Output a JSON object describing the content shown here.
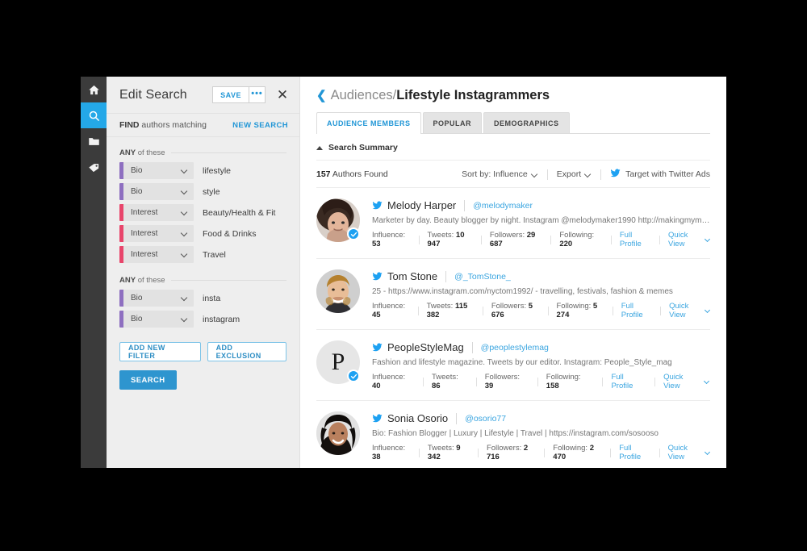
{
  "rail": {
    "items": [
      {
        "name": "home-icon",
        "label": "Home"
      },
      {
        "name": "search-icon",
        "label": "Search",
        "active": true
      },
      {
        "name": "folder-icon",
        "label": "Folders"
      },
      {
        "name": "tag-icon",
        "label": "Tags"
      }
    ],
    "active_color": "#24a8e8",
    "background": "#3b3b3b"
  },
  "edit_panel": {
    "title": "Edit Search",
    "save_label": "SAVE",
    "more_label": "•••",
    "close_label": "✕",
    "find_prefix": "FIND",
    "find_suffix": "authors matching",
    "new_search_label": "NEW SEARCH",
    "group1": {
      "any_bold": "ANY",
      "any_rest": "of these",
      "filters": [
        {
          "field": "Bio",
          "value": "lifestyle",
          "color": "#8e6fc0",
          "kind": "bio"
        },
        {
          "field": "Bio",
          "value": "style",
          "color": "#8e6fc0",
          "kind": "bio"
        },
        {
          "field": "Interest",
          "value": "Beauty/Health & Fit",
          "color": "#e8456b",
          "kind": "interest"
        },
        {
          "field": "Interest",
          "value": "Food & Drinks",
          "color": "#e8456b",
          "kind": "interest"
        },
        {
          "field": "Interest",
          "value": "Travel",
          "color": "#e8456b",
          "kind": "interest"
        }
      ]
    },
    "group2": {
      "any_bold": "ANY",
      "any_rest": "of these",
      "filters": [
        {
          "field": "Bio",
          "value": "insta",
          "color": "#8e6fc0",
          "kind": "bio"
        },
        {
          "field": "Bio",
          "value": "instagram",
          "color": "#8e6fc0",
          "kind": "bio"
        }
      ]
    },
    "add_filter_label": "ADD NEW FILTER",
    "add_exclusion_label": "ADD EXCLUSION",
    "search_label": "SEARCH"
  },
  "main": {
    "breadcrumb": {
      "back_icon": "❮",
      "parent": "Audiences/",
      "current": "Lifestyle Instagrammers"
    },
    "tabs": [
      {
        "label": "AUDIENCE MEMBERS",
        "active": true
      },
      {
        "label": "POPULAR",
        "active": false
      },
      {
        "label": "DEMOGRAPHICS",
        "active": false
      }
    ],
    "summary_label": "Search Summary",
    "found_count": "157",
    "found_suffix": "Authors Found",
    "sort_label": "Sort by: Influence",
    "export_label": "Export",
    "twitter_ads_label": "Target with Twitter Ads",
    "stat_labels": {
      "influence": "Influence:",
      "tweets": "Tweets:",
      "followers": "Followers:",
      "following": "Following:"
    },
    "full_profile_label": "Full Profile",
    "quick_view_label": "Quick View",
    "results": [
      {
        "name": "Melody Harper",
        "handle": "@melodymaker",
        "bio": "Marketer by day. Beauty blogger by night. Instagram @melodymaker1990 http://makingmymelody.me",
        "influence": "53",
        "tweets": "10 947",
        "followers": "29 687",
        "following": "220",
        "verified": true,
        "avatar_type": "photo-woman-brunette",
        "avatar_letter": ""
      },
      {
        "name": "Tom Stone",
        "handle": "@_TomStone_",
        "bio": "25 - https://www.instagram.com/nyctom1992/ - travelling, festivals, fashion & memes",
        "influence": "45",
        "tweets": "115 382",
        "followers": "5 676",
        "following": "5 274",
        "verified": false,
        "avatar_type": "photo-man-blond",
        "avatar_letter": ""
      },
      {
        "name": "PeopleStyleMag",
        "handle": "@peoplestylemag",
        "bio": "Fashion and lifestyle magazine. Tweets by our editor. Instagram: People_Style_mag",
        "influence": "40",
        "tweets": "86",
        "followers": "39",
        "following": "158",
        "verified": true,
        "avatar_type": "letter",
        "avatar_letter": "P"
      },
      {
        "name": "Sonia Osorio",
        "handle": "@osorio77",
        "bio": "Bio: Fashion Blogger | Luxury | Lifestyle | Travel | https://instagram.com/sosooso",
        "influence": "38",
        "tweets": "9 342",
        "followers": "2 716",
        "following": "2 470",
        "verified": false,
        "avatar_type": "photo-woman-dark",
        "avatar_letter": ""
      }
    ]
  }
}
